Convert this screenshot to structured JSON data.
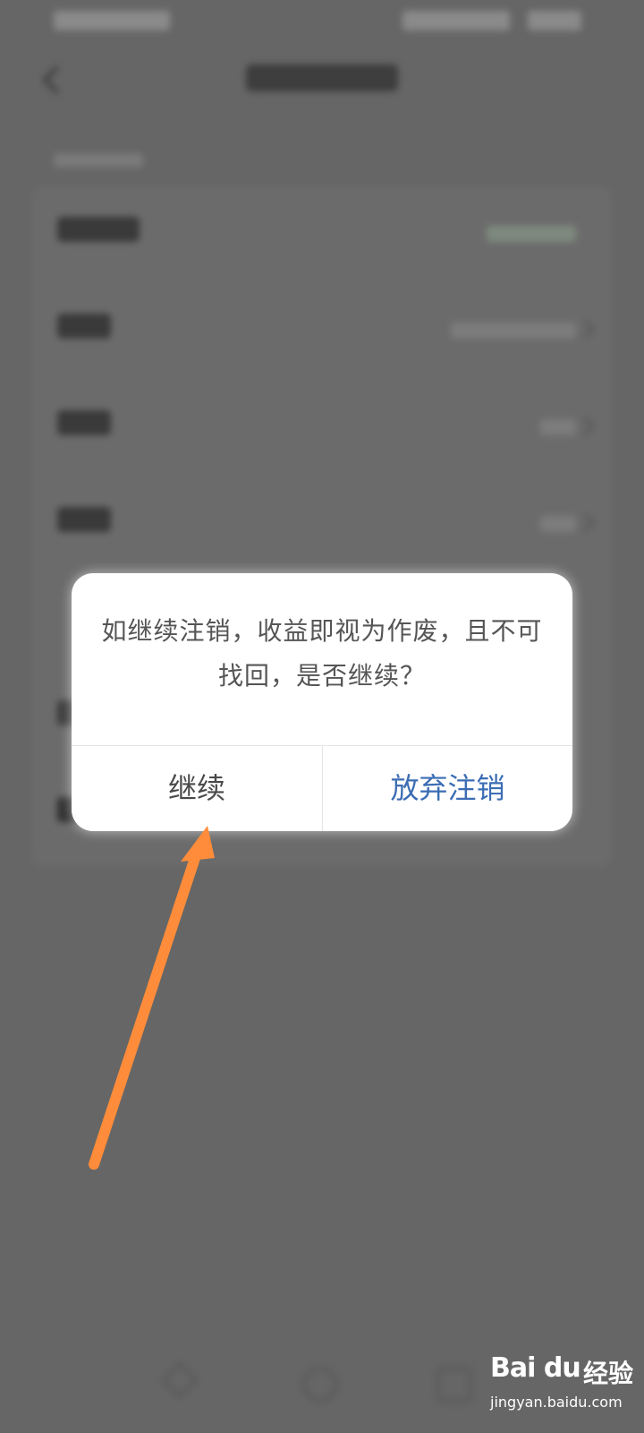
{
  "dialog": {
    "message": "如继续注销，收益即视为作废，且不可找回，是否继续？",
    "continue_label": "继续",
    "abandon_label": "放弃注销"
  },
  "watermark": {
    "logo_text": "Bai du",
    "brand_text": "经验",
    "url": "jingyan.baidu.com"
  },
  "colors": {
    "overlay": "#666666",
    "dialog_bg": "#ffffff",
    "abandon_text": "#3c6db4",
    "continue_text": "#4a4a4a",
    "arrow": "#ff8c3a"
  },
  "icons": {
    "back": "back-chevron-icon",
    "row_arrow": "chevron-right-icon"
  }
}
